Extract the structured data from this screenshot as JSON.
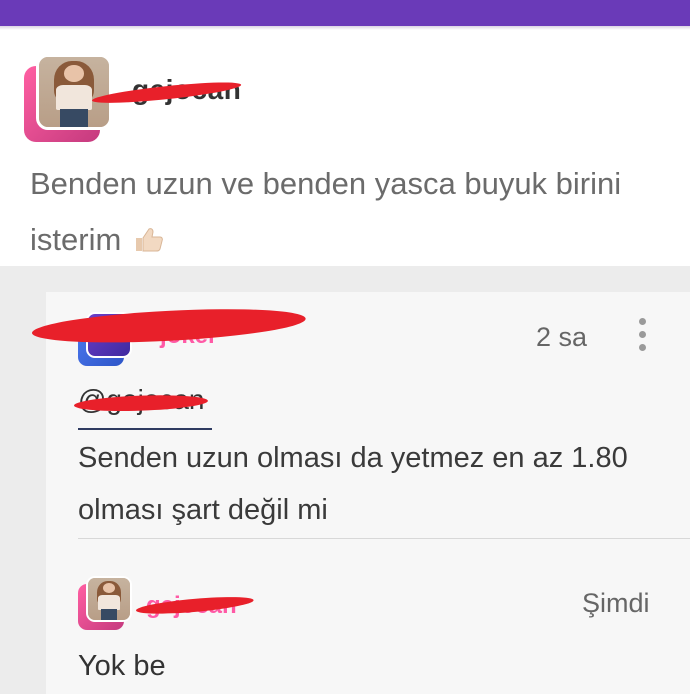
{
  "header": {
    "color": "#6a3ab8"
  },
  "post": {
    "username": "gejocan",
    "text": "Benden uzun ve benden yasca buyuk birini isterim",
    "emoji": "thumbs-up-icon"
  },
  "comments": [
    {
      "username": "joker",
      "time": "2 sa",
      "mention": "@gejocan",
      "text": "Senden uzun olması da yetmez en az 1.80 olması şart değil mi",
      "menu_icon": "more-vertical-icon"
    },
    {
      "username": "gejocan",
      "time": "Şimdi",
      "text": "Yok be"
    }
  ],
  "colors": {
    "accent_pink": "#ff5aa6",
    "redaction": "#e8202a"
  }
}
